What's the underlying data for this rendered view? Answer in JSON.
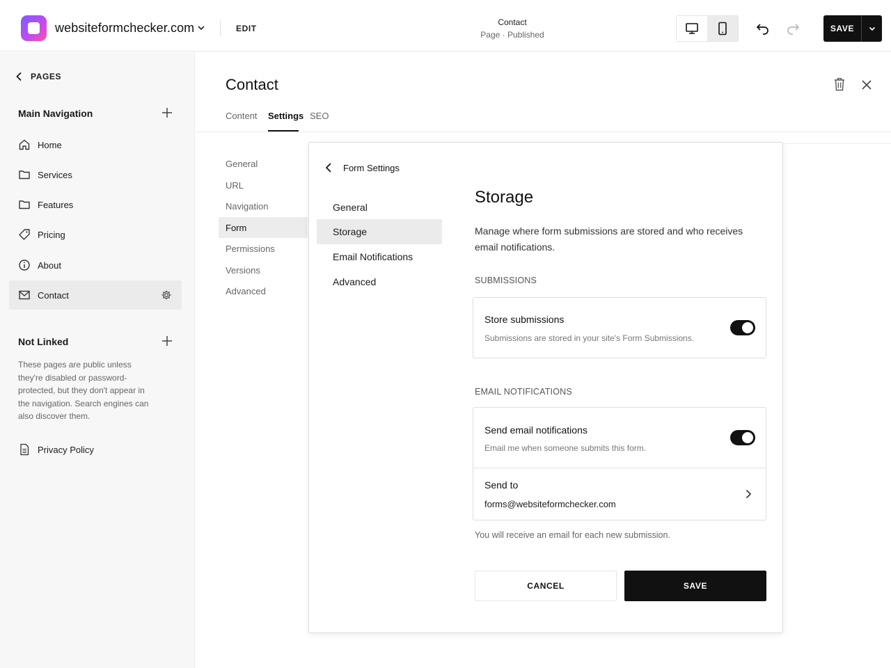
{
  "topbar": {
    "site_name": "websiteformchecker.com",
    "edit_label": "EDIT",
    "page_title": "Contact",
    "page_status": "Page · Published",
    "save_label": "SAVE",
    "device_icons": [
      "desktop-icon",
      "mobile-icon"
    ],
    "active_device": "mobile"
  },
  "sidebar": {
    "back_label": "PAGES",
    "main_nav_title": "Main Navigation",
    "main_nav_items": [
      {
        "label": "Home",
        "icon": "home-icon"
      },
      {
        "label": "Services",
        "icon": "folder-icon"
      },
      {
        "label": "Features",
        "icon": "folder-icon"
      },
      {
        "label": "Pricing",
        "icon": "tag-icon"
      },
      {
        "label": "About",
        "icon": "info-icon"
      },
      {
        "label": "Contact",
        "icon": "mail-icon",
        "active": true
      }
    ],
    "not_linked_title": "Not Linked",
    "not_linked_desc": "These pages are public unless they're disabled or password-protected, but they don't appear in the navigation. Search engines can also discover them.",
    "not_linked_items": [
      {
        "label": "Privacy Policy",
        "icon": "document-icon"
      }
    ]
  },
  "main": {
    "title": "Contact",
    "tabs": [
      {
        "label": "Content"
      },
      {
        "label": "Settings",
        "active": true
      },
      {
        "label": "SEO"
      }
    ],
    "settings_nav": [
      {
        "label": "General"
      },
      {
        "label": "URL"
      },
      {
        "label": "Navigation"
      },
      {
        "label": "Form",
        "active": true
      },
      {
        "label": "Permissions"
      },
      {
        "label": "Versions"
      },
      {
        "label": "Advanced"
      }
    ]
  },
  "dialog": {
    "back_label": "Form Settings",
    "nav": [
      {
        "label": "General"
      },
      {
        "label": "Storage",
        "active": true
      },
      {
        "label": "Email Notifications"
      },
      {
        "label": "Advanced"
      }
    ],
    "title": "Storage",
    "description": "Manage where form submissions are stored and who receives email notifications.",
    "submissions_heading": "SUBMISSIONS",
    "store_title": "Store submissions",
    "store_desc": "Submissions are stored in your site's Form Submissions.",
    "store_enabled": true,
    "email_heading": "EMAIL NOTIFICATIONS",
    "email_title": "Send email notifications",
    "email_desc": "Email me when someone submits this form.",
    "email_enabled": true,
    "send_to_label": "Send to",
    "send_to_email": "forms@websiteformchecker.com",
    "note": "You will receive an email for each new submission.",
    "cancel_label": "CANCEL",
    "save_label": "SAVE"
  },
  "colors": {
    "accent": "#111111",
    "sidebar_bg": "#f7f7f7",
    "active_bg": "#ebebeb",
    "logo_gradient": [
      "#7b5cff",
      "#c04cf0",
      "#ff4fa8"
    ]
  }
}
